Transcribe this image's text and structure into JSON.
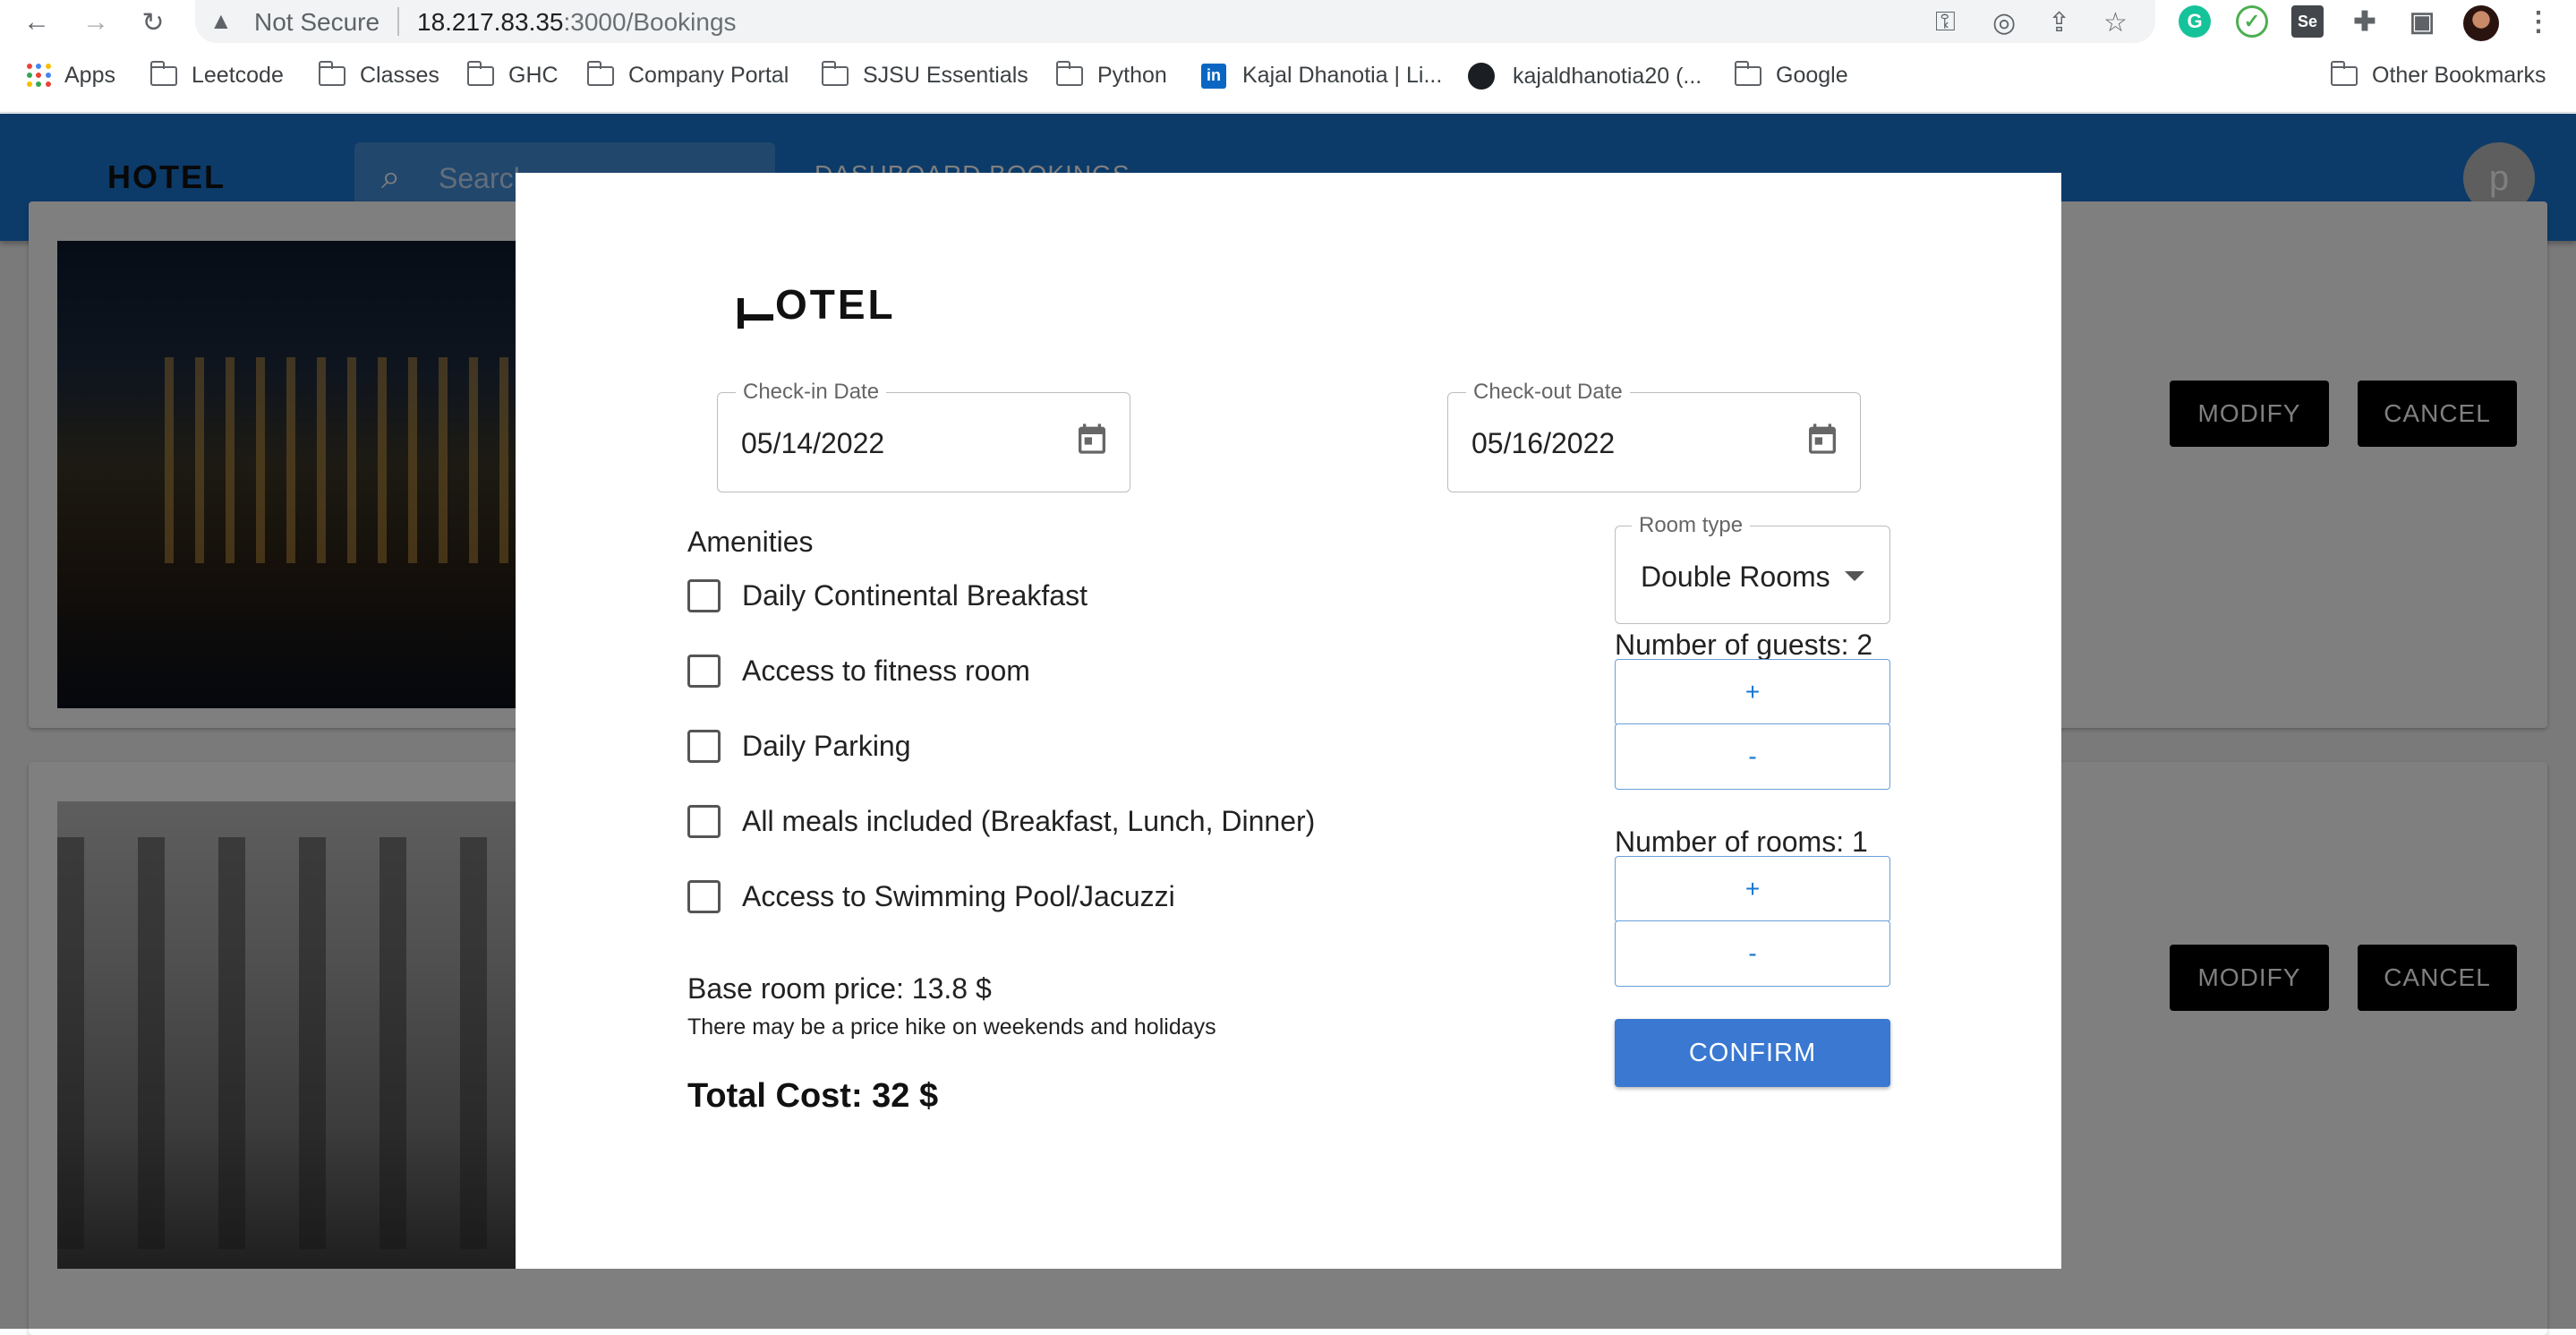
{
  "browser": {
    "omnibox": {
      "security_label": "Not Secure",
      "url_host": "18.217.83.35",
      "url_rest": ":3000/Bookings"
    },
    "icons": [
      "back-icon",
      "forward-icon",
      "reload-icon",
      "warning-icon",
      "key-icon",
      "eye-off-icon",
      "share-icon",
      "star-icon",
      "grammarly-icon",
      "check-extension-icon",
      "selenium-icon",
      "puzzle-icon",
      "sidepanel-icon",
      "profile-avatar",
      "menu-icon"
    ],
    "extension_labels": {
      "grammarly": "G",
      "selenium": "Se"
    },
    "bookmarks": [
      {
        "label": "Apps"
      },
      {
        "label": "Leetcode"
      },
      {
        "label": "Classes"
      },
      {
        "label": "GHC"
      },
      {
        "label": "Company Portal"
      },
      {
        "label": "SJSU Essentials"
      },
      {
        "label": "Python"
      },
      {
        "label": "Kajal Dhanotia | Li..."
      },
      {
        "label": "kajaldhanotia20 (..."
      },
      {
        "label": "Google"
      }
    ],
    "other_bookmarks": "Other Bookmarks"
  },
  "app": {
    "logo": "HOTEL",
    "search_placeholder": "Search…",
    "nav": "DASHBOARD   BOOKINGS",
    "avatar_letter": "p",
    "bookings": [
      {
        "modify_label": "MODIFY",
        "cancel_label": "CANCEL"
      },
      {
        "modify_label": "MODIFY",
        "cancel_label": "CANCEL"
      }
    ]
  },
  "modal": {
    "logo_text": "OTEL",
    "checkin": {
      "label": "Check-in Date",
      "value": "05/14/2022"
    },
    "checkout": {
      "label": "Check-out Date",
      "value": "05/16/2022"
    },
    "amenities_title": "Amenities",
    "amenities": [
      {
        "label": "Daily Continental Breakfast",
        "checked": false
      },
      {
        "label": "Access to fitness room",
        "checked": false
      },
      {
        "label": "Daily Parking",
        "checked": false
      },
      {
        "label": "All meals included (Breakfast, Lunch, Dinner)",
        "checked": false
      },
      {
        "label": "Access to Swimming Pool/Jacuzzi",
        "checked": false
      }
    ],
    "room_type": {
      "label": "Room type",
      "value": "Double Rooms"
    },
    "guests": {
      "label": "Number of guests: 2",
      "plus": "+",
      "minus": "-"
    },
    "rooms": {
      "label": "Number of rooms: 1",
      "plus": "+",
      "minus": "-"
    },
    "confirm_label": "CONFIRM",
    "base_price": "Base room price: 13.8 $",
    "price_note": "There may be a price hike on weekends and holidays",
    "total": "Total Cost: 32 $"
  },
  "colors": {
    "appbar": "#1976d2",
    "confirm": "#3a78d1",
    "outline_button_border": "#6a9fd8",
    "card_button": "#000000"
  }
}
